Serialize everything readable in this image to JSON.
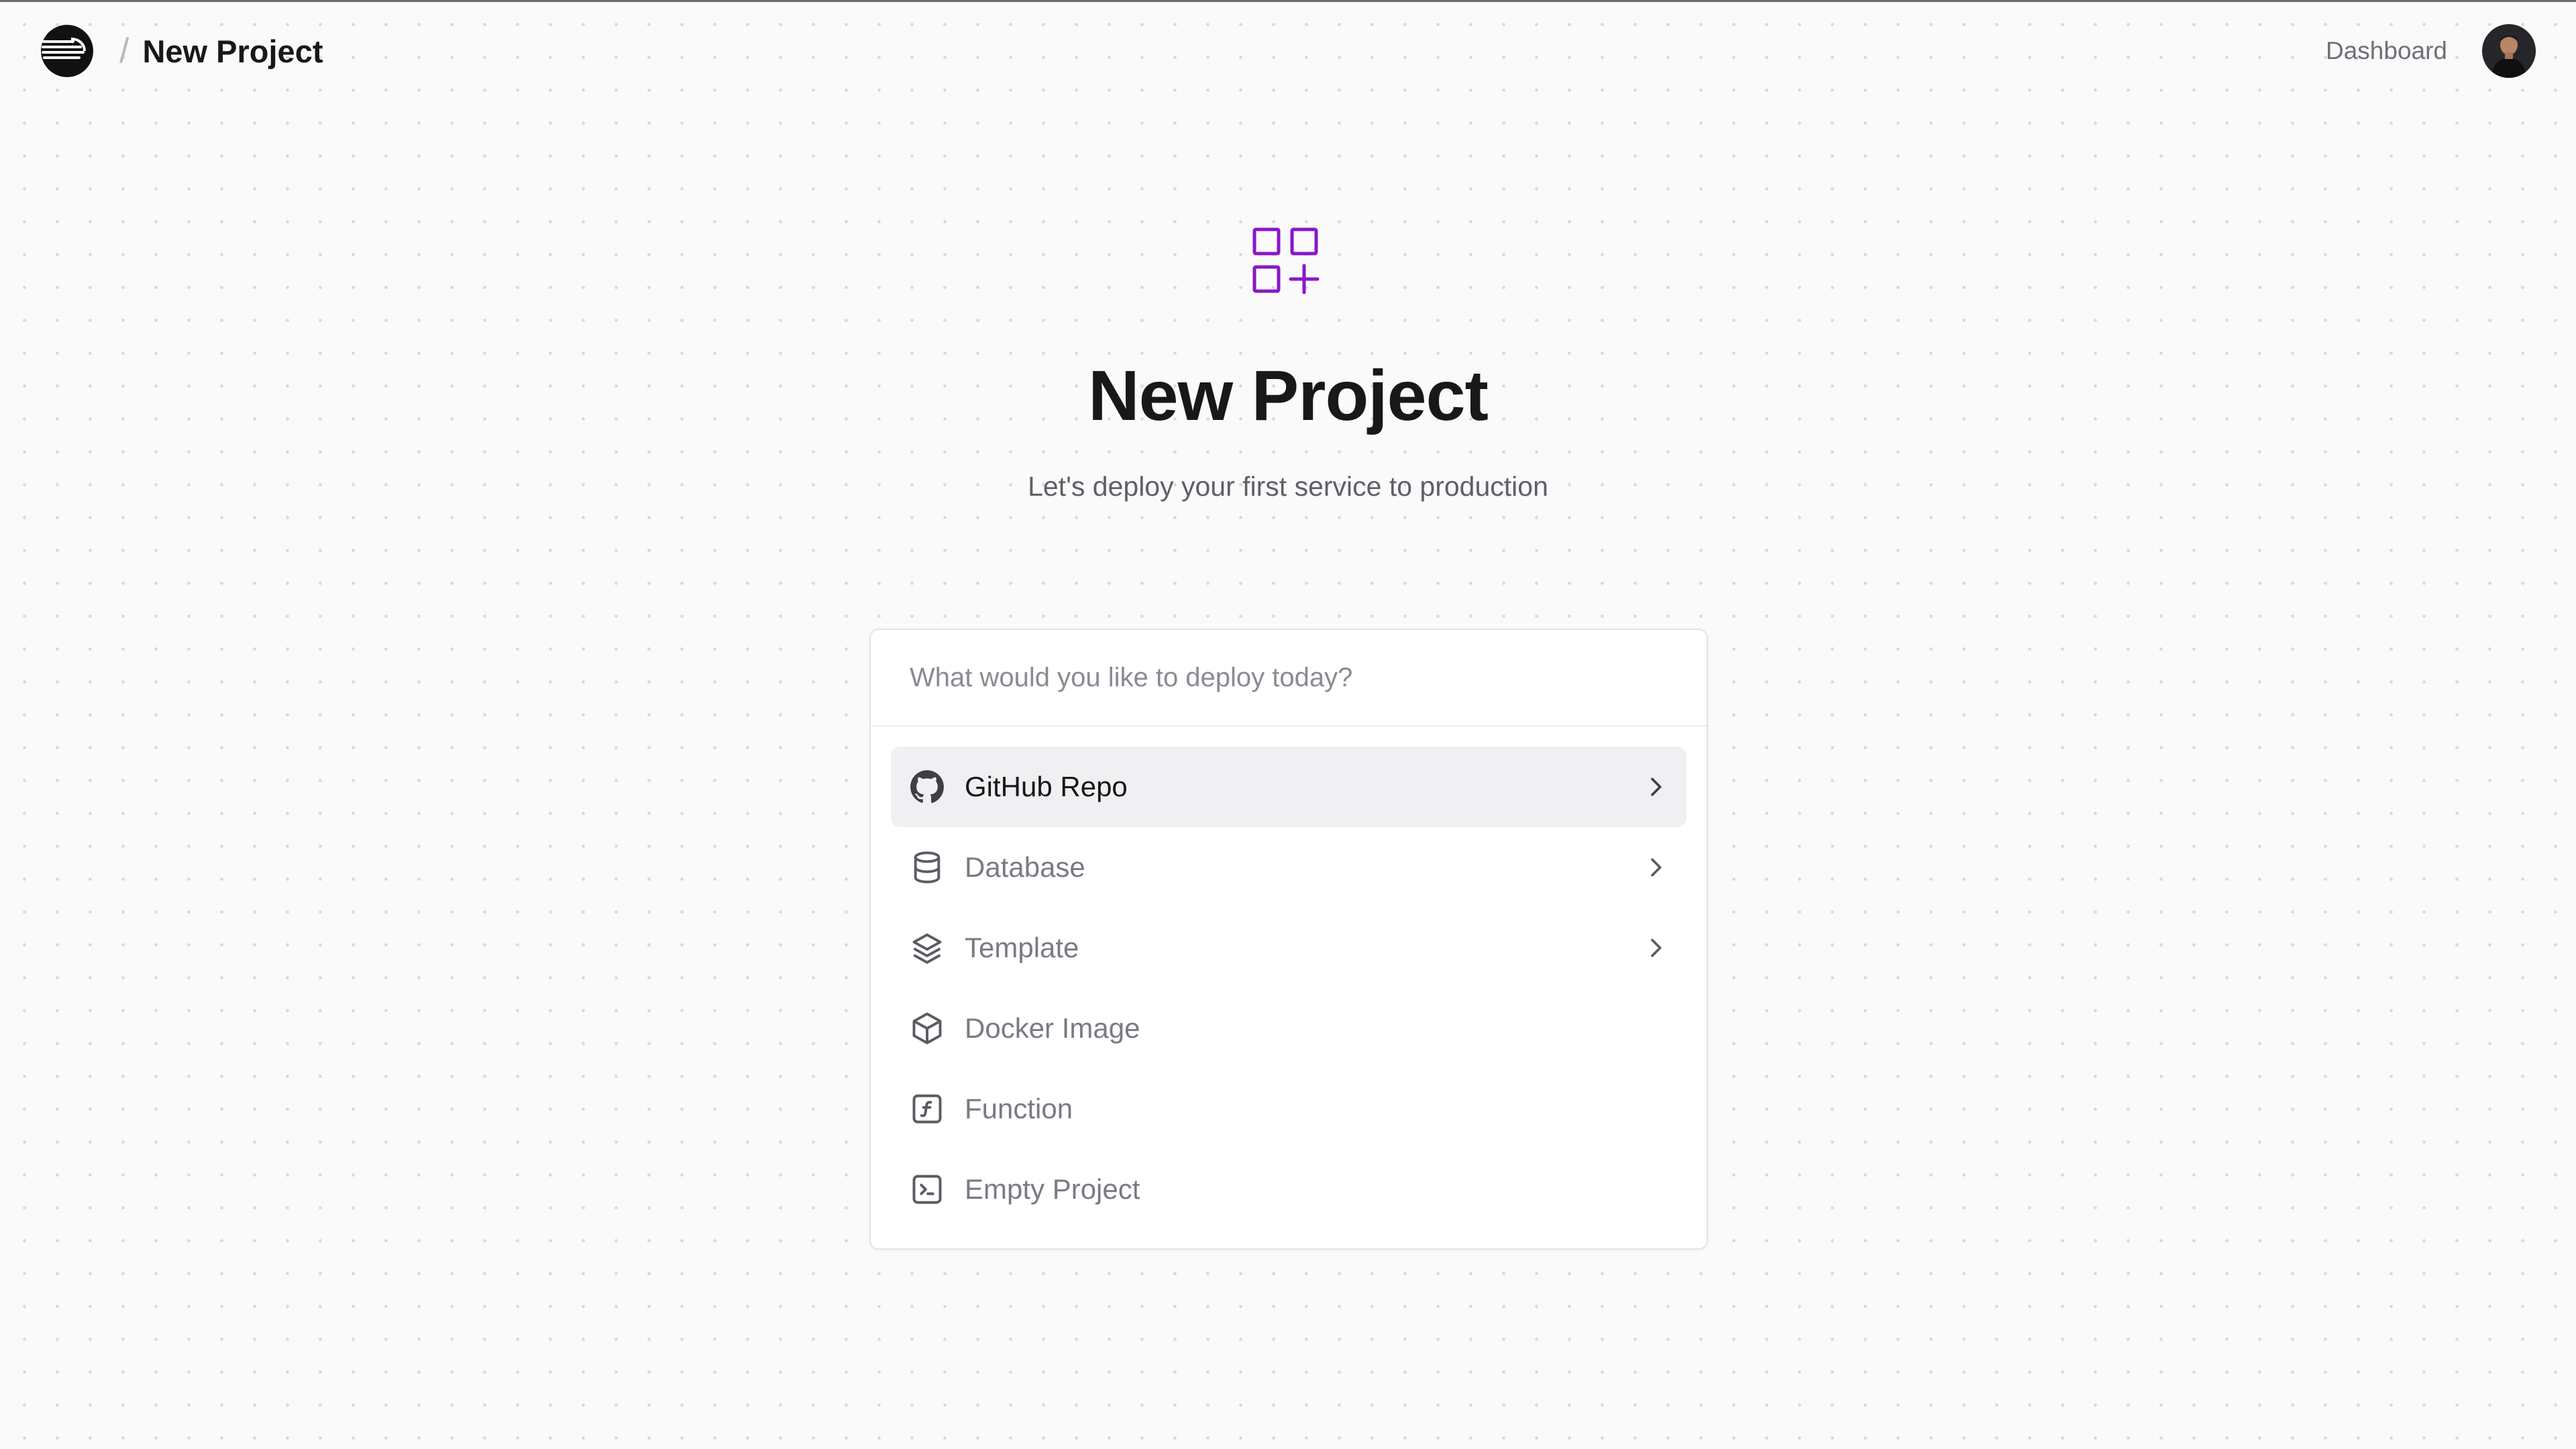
{
  "header": {
    "breadcrumb_title": "New Project",
    "separator": "/",
    "dashboard_link": "Dashboard"
  },
  "hero": {
    "title": "New Project",
    "subtitle": "Let's deploy your first service to production",
    "icon": "grid-plus-icon"
  },
  "deploy_card": {
    "search_placeholder": "What would you like to deploy today?",
    "search_value": "",
    "options": [
      {
        "label": "GitHub Repo",
        "icon": "github-icon",
        "has_submenu": true,
        "highlighted": true
      },
      {
        "label": "Database",
        "icon": "database-icon",
        "has_submenu": true,
        "highlighted": false
      },
      {
        "label": "Template",
        "icon": "layers-icon",
        "has_submenu": true,
        "highlighted": false
      },
      {
        "label": "Docker Image",
        "icon": "box-icon",
        "has_submenu": false,
        "highlighted": false
      },
      {
        "label": "Function",
        "icon": "function-icon",
        "has_submenu": false,
        "highlighted": false
      },
      {
        "label": "Empty Project",
        "icon": "terminal-icon",
        "has_submenu": false,
        "highlighted": false
      }
    ]
  },
  "colors": {
    "accent": "#8a16c8",
    "background": "#fafafa",
    "highlight_row": "#f0f0f2",
    "muted_text": "#7a7a84"
  }
}
